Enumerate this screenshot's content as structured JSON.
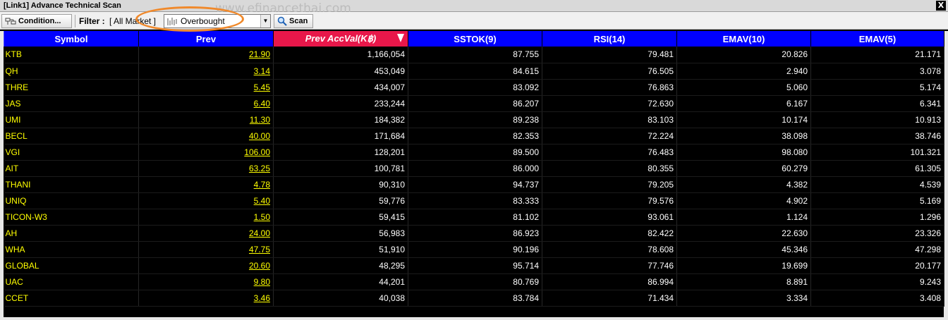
{
  "window": {
    "title": "[Link1] Advance Technical Scan",
    "close_label": "X",
    "watermark": "www.efinancethai.com"
  },
  "toolbar": {
    "condition_label": "Condition...",
    "filter_label": "Filter :",
    "filter_value": "[ All Market ]",
    "condition_select_value": "Overbought",
    "scan_label": "Scan"
  },
  "table": {
    "columns": [
      "Symbol",
      "Prev",
      "Prev AccVal(K฿)",
      "SSTOK(9)",
      "RSI(14)",
      "EMAV(10)",
      "EMAV(5)"
    ],
    "sorted_column": 2,
    "rows": [
      [
        "KTB",
        "21.90",
        "1,166,054",
        "87.755",
        "79.481",
        "20.826",
        "21.171"
      ],
      [
        "QH",
        "3.14",
        "453,049",
        "84.615",
        "76.505",
        "2.940",
        "3.078"
      ],
      [
        "THRE",
        "5.45",
        "434,007",
        "83.092",
        "76.863",
        "5.060",
        "5.174"
      ],
      [
        "JAS",
        "6.40",
        "233,244",
        "86.207",
        "72.630",
        "6.167",
        "6.341"
      ],
      [
        "UMI",
        "11.30",
        "184,382",
        "89.238",
        "83.103",
        "10.174",
        "10.913"
      ],
      [
        "BECL",
        "40.00",
        "171,684",
        "82.353",
        "72.224",
        "38.098",
        "38.746"
      ],
      [
        "VGI",
        "106.00",
        "128,201",
        "89.500",
        "76.483",
        "98.080",
        "101.321"
      ],
      [
        "AIT",
        "63.25",
        "100,781",
        "86.000",
        "80.355",
        "60.279",
        "61.305"
      ],
      [
        "THANI",
        "4.78",
        "90,310",
        "94.737",
        "79.205",
        "4.382",
        "4.539"
      ],
      [
        "UNIQ",
        "5.40",
        "59,776",
        "83.333",
        "79.576",
        "4.902",
        "5.169"
      ],
      [
        "TICON-W3",
        "1.50",
        "59,415",
        "81.102",
        "93.061",
        "1.124",
        "1.296"
      ],
      [
        "AH",
        "24.00",
        "56,983",
        "86.923",
        "82.422",
        "22.630",
        "23.326"
      ],
      [
        "WHA",
        "47.75",
        "51,910",
        "90.196",
        "78.608",
        "45.346",
        "47.298"
      ],
      [
        "GLOBAL",
        "20.60",
        "48,295",
        "95.714",
        "77.746",
        "19.699",
        "20.177"
      ],
      [
        "UAC",
        "9.80",
        "44,201",
        "80.769",
        "86.994",
        "8.891",
        "9.243"
      ],
      [
        "CCET",
        "3.46",
        "40,038",
        "83.784",
        "71.434",
        "3.334",
        "3.408"
      ]
    ]
  },
  "colors": {
    "header_bg": "#0000ff",
    "sorted_header_bg": "#e8174a",
    "symbol_text": "#ffff00",
    "grid_bg": "#000000",
    "highlight_ring": "#f0892b"
  },
  "icons": {
    "condition": "condition-icon",
    "select": "chart-icon",
    "scan": "magnifier-icon"
  }
}
